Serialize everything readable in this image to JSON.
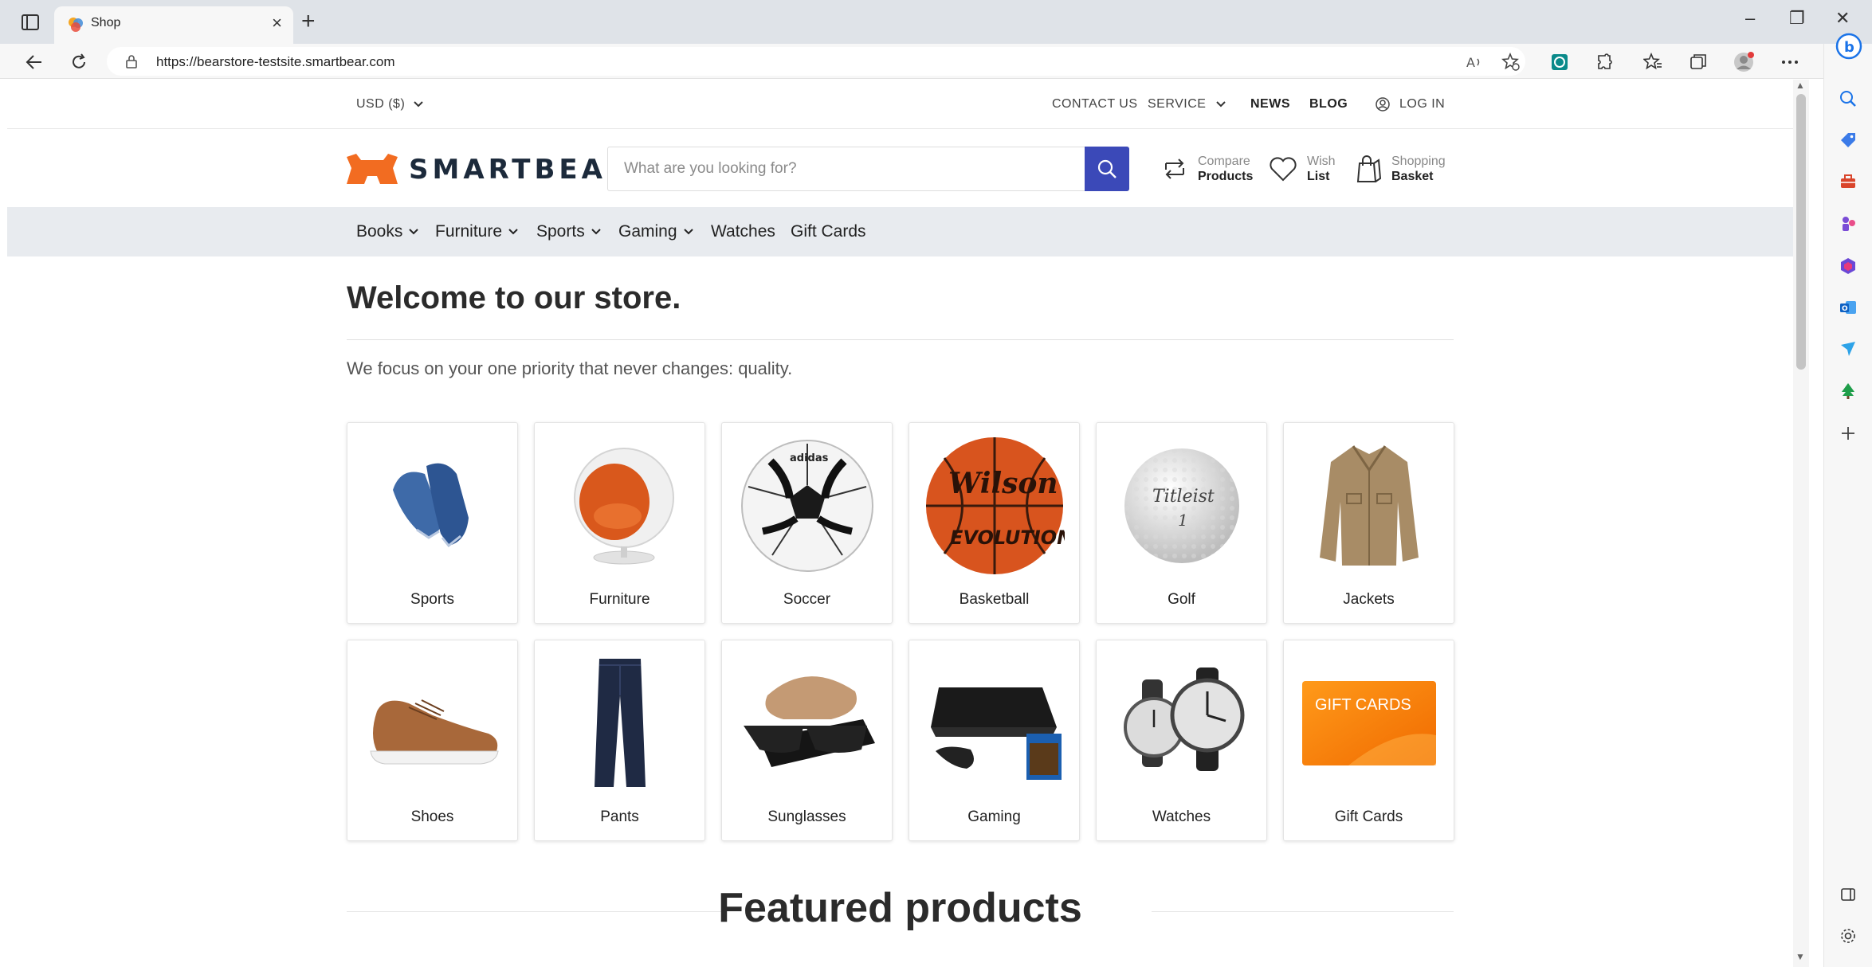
{
  "browser": {
    "tab_title": "Shop",
    "url": "https://bearstore-testsite.smartbear.com"
  },
  "topbar": {
    "currency": "USD  ($)",
    "links": [
      "CONTACT US",
      "SERVICE",
      "NEWS",
      "BLOG",
      "LOG IN"
    ]
  },
  "header": {
    "logo_text": "SMARTBEAR",
    "search_placeholder": "What are you looking for?",
    "compare": {
      "small": "Compare",
      "big": "Products"
    },
    "wish": {
      "small": "Wish",
      "big": "List"
    },
    "basket": {
      "small": "Shopping",
      "big": "Basket"
    }
  },
  "categories_nav": [
    "Books",
    "Furniture",
    "Sports",
    "Gaming",
    "Watches",
    "Gift Cards"
  ],
  "main": {
    "welcome": "Welcome to our store.",
    "tagline": "We focus on your one priority that never changes: quality.",
    "tiles": [
      "Sports",
      "Furniture",
      "Soccer",
      "Basketball",
      "Golf",
      "Jackets",
      "Shoes",
      "Pants",
      "Sunglasses",
      "Gaming",
      "Watches",
      "Gift Cards"
    ],
    "gift_card_text": "GIFT CARDS",
    "basketball_text_1": "Wilson",
    "basketball_text_2": "EVOLUTION",
    "golf_text": "Titleist",
    "golf_number": "1",
    "featured": "Featured products"
  },
  "colors": {
    "brand_orange": "#f26c21",
    "search_button": "#3b49b8",
    "nav_background": "#e8ebef"
  }
}
